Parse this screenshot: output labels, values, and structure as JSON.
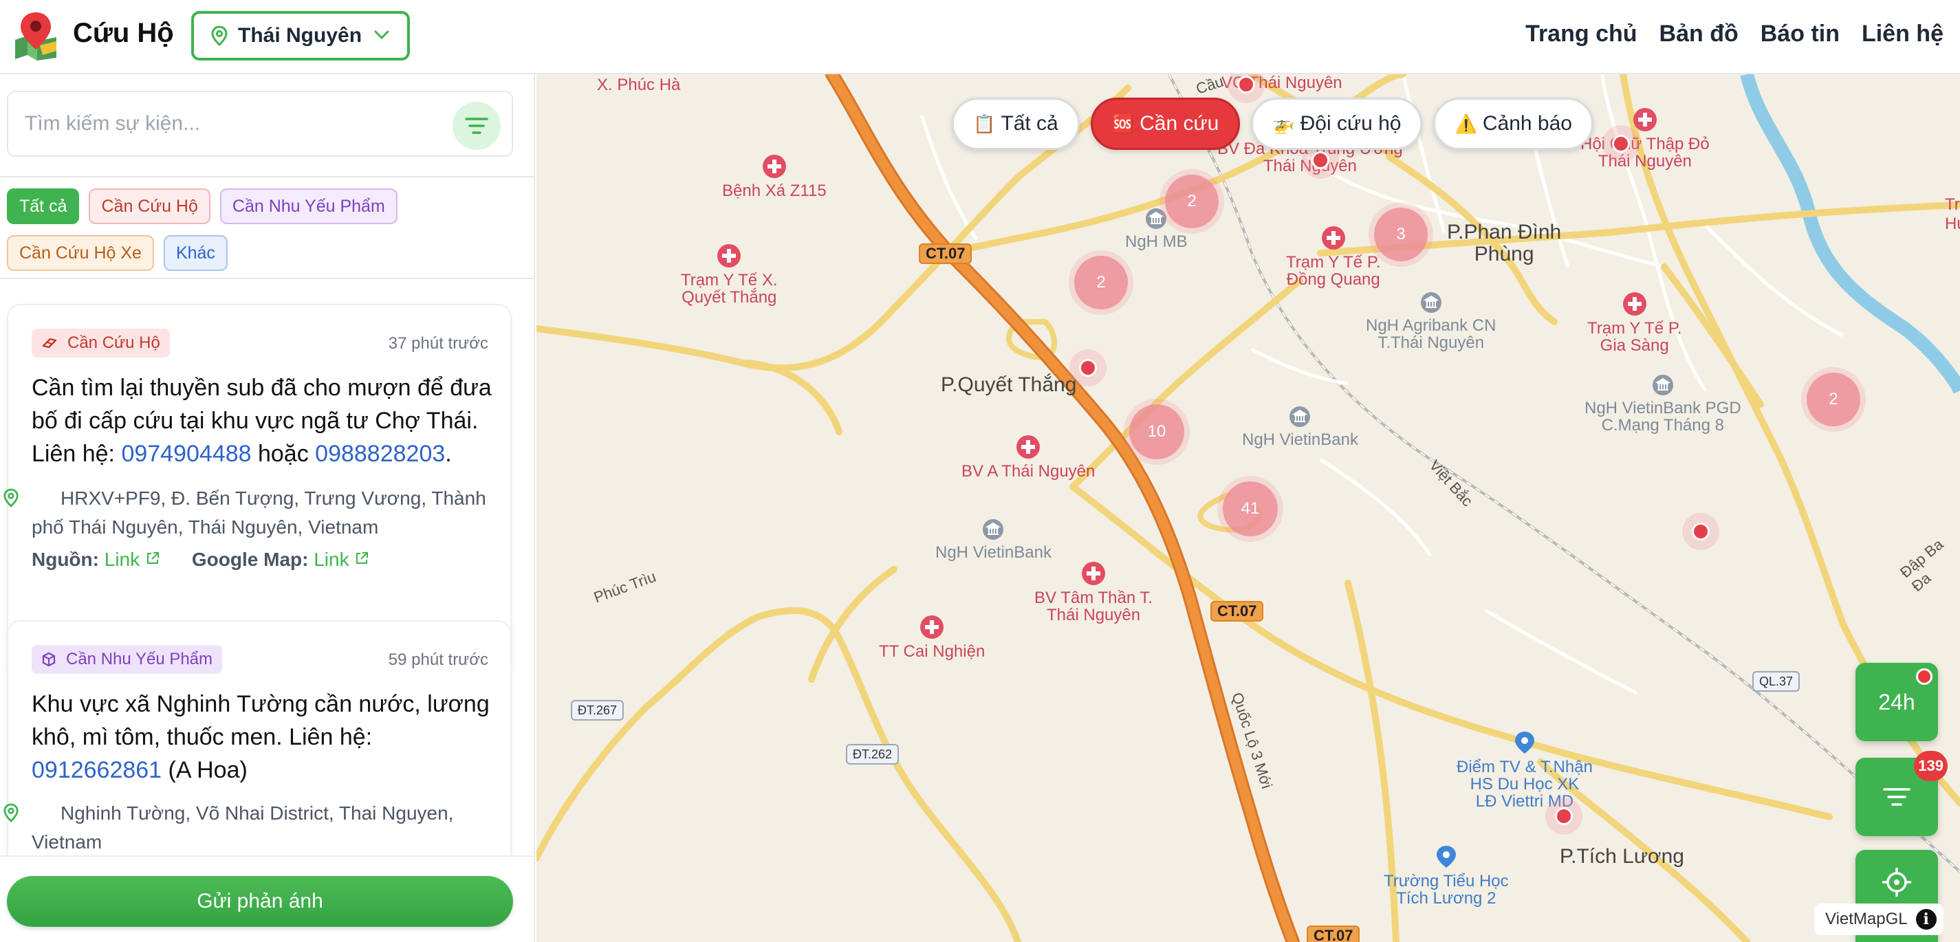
{
  "header": {
    "app_title": "Cứu Hộ",
    "province": "Thái Nguyên",
    "nav": [
      "Trang chủ",
      "Bản đồ",
      "Báo tin",
      "Liên hệ"
    ]
  },
  "sidebar": {
    "search_placeholder": "Tìm kiếm sự kiện...",
    "categories": [
      "Tất cả",
      "Cần Cứu Hộ",
      "Cần Nhu Yếu Phẩm",
      "Cần Cứu Hộ Xe",
      "Khác"
    ],
    "posts": [
      {
        "category": "Cần Cứu Hộ",
        "time": "37 phút trước",
        "text_before": "Cần tìm lại thuyền sub đã cho mượn để đưa bố đi cấp cứu tại khu vực ngã tư Chợ Thái. Liên hệ: ",
        "phone1": "0974904488",
        "text_mid": " hoặc ",
        "phone2": "0988828203",
        "text_after": ".",
        "address": "HRXV+PF9, Đ. Bến Tượng, Trưng Vương, Thành phố Thái Nguyên, Thái Nguyên, Vietnam",
        "source_label": "Nguồn:",
        "source_link": "Link",
        "gmap_label": "Google Map:",
        "gmap_link": "Link"
      },
      {
        "category": "Cần Nhu Yếu Phẩm",
        "time": "59 phút trước",
        "text_before": "Khu vực xã Nghinh Tường cần nước, lương khô, mì tôm, thuốc men. Liên hệ: ",
        "phone1": "0912662861",
        "text_after": " (A Hoa)",
        "address": "Nghinh Tường, Võ Nhai District, Thai Nguyen, Vietnam"
      }
    ],
    "send_button": "Gửi phản ánh"
  },
  "map": {
    "filter_pills": [
      {
        "icon": "📋",
        "label": "Tất cả"
      },
      {
        "icon": "🆘",
        "label": "Cần cứu"
      },
      {
        "icon": "🚁",
        "label": "Đội cứu hộ"
      },
      {
        "icon": "⚠️",
        "label": "Cảnh báo"
      }
    ],
    "places": {
      "quyet_thang": "P.Quyết Thắng",
      "phan_dinh_phung_1": "P.Phan Đình",
      "phan_dinh_phung_2": "Phùng",
      "tich_luong": "P.Tích Lương",
      "phuc_ha": "X. Phúc Hà"
    },
    "pois": {
      "benh_xa": "Bệnh Xá Z115",
      "tram_qt_1": "Trạm Y Tế X.",
      "tram_qt_2": "Quyết Thắng",
      "ngh_mb": "NgH MB",
      "bv_dk_1": "BV Đa Khoa Trung Ương",
      "bv_dk_2": "Thái Nguyên",
      "vc_tn": "VC Thái Nguyên",
      "tram_dq_1": "Trạm Y Tế P.",
      "tram_dq_2": "Đồng Quang",
      "agri_1": "NgH Agribank CN",
      "agri_2": "T.Thái Nguyên",
      "hoi_chu_1": "Hội Chữ Thập Đỏ",
      "hoi_chu_2": "Thái Nguyên",
      "tram_gs_1": "Trạm Y Tế P.",
      "tram_gs_2": "Gia Sàng",
      "vtb_pgd_1": "NgH VietinBank PGD",
      "vtb_pgd_2": "C.Mạng Tháng 8",
      "bv_a": "BV A Thái Nguyên",
      "vtb_1": "NgH VietinBank",
      "vtb_2": "NgH VietinBank",
      "bv_tt_1": "BV Tâm Thần T.",
      "bv_tt_2": "Thái Nguyên",
      "tt_cai": "TT Cai Nghiện",
      "diem_tv_1": "Điểm TV & T.Nhận",
      "diem_tv_2": "HS Du Học XK",
      "diem_tv_3": "LĐ Viettri MD",
      "truong_1": "Trường Tiểu Học",
      "truong_2": "Tích Lương 2",
      "tru_1": "Tr",
      "tru_2": "Hu"
    },
    "roads": {
      "ct07": "CT.07",
      "dt267": "ĐT.267",
      "dt262": "ĐT.262",
      "ql37": "QL.37",
      "quoc_lo": "Quốc Lộ 3 Mới",
      "phuc_triu": "Phúc Trìu",
      "viet_bac": "Việt Bắc",
      "dap_ba_da": "Đập Ba Đa",
      "cau": "Cầu"
    },
    "clusters": [
      "2",
      "2",
      "3",
      "10",
      "41",
      "2"
    ],
    "fab_24h": "24h",
    "fab_badge": "139",
    "attribution": "VietMapGL",
    "info_icon": "i",
    "colors": {
      "accent": "#3fb34f",
      "danger": "#e5393d",
      "highway": "#ee8a32"
    }
  }
}
